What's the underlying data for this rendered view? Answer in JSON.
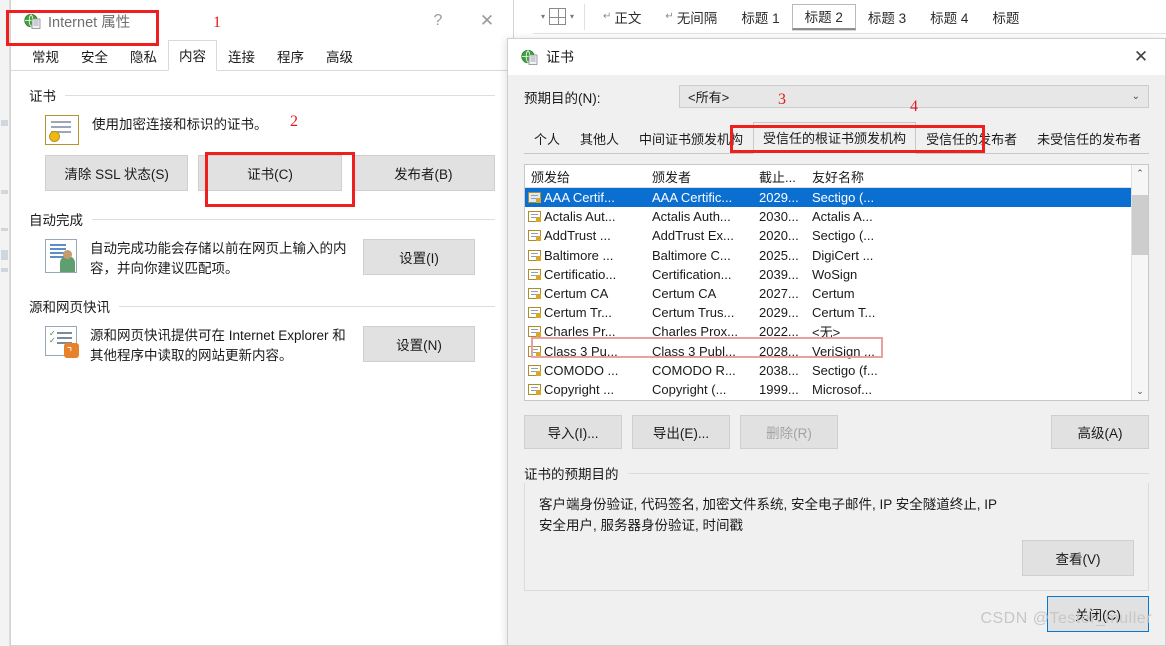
{
  "ribbon": {
    "table_button": "table-grid",
    "styles": [
      {
        "label": "正文",
        "pilcrow": "↵",
        "selected": false
      },
      {
        "label": "无间隔",
        "pilcrow": "↵",
        "selected": false
      },
      {
        "label": "标题 1",
        "pilcrow": "",
        "selected": false
      },
      {
        "label": "标题 2",
        "pilcrow": "",
        "selected": true
      },
      {
        "label": "标题 3",
        "pilcrow": "",
        "selected": false
      },
      {
        "label": "标题 4",
        "pilcrow": "",
        "selected": false
      },
      {
        "label": "标题",
        "pilcrow": "",
        "selected": false
      }
    ]
  },
  "internet_properties": {
    "title": "Internet 属性",
    "help_glyph": "?",
    "close_glyph": "✕",
    "tabs": [
      {
        "label": "常规",
        "active": false
      },
      {
        "label": "安全",
        "active": false
      },
      {
        "label": "隐私",
        "active": false
      },
      {
        "label": "内容",
        "active": true
      },
      {
        "label": "连接",
        "active": false
      },
      {
        "label": "程序",
        "active": false
      },
      {
        "label": "高级",
        "active": false
      }
    ],
    "certificates_group": {
      "title": "证书",
      "description": "使用加密连接和标识的证书。",
      "buttons": [
        {
          "label": "清除 SSL 状态(S)"
        },
        {
          "label": "证书(C)"
        },
        {
          "label": "发布者(B)"
        }
      ]
    },
    "autocomplete_group": {
      "title": "自动完成",
      "description": "自动完成功能会存储以前在网页上输入的内容，并向你建议匹配项。",
      "button": "设置(I)"
    },
    "feeds_group": {
      "title": "源和网页快讯",
      "description": "源和网页快讯提供可在 Internet Explorer 和其他程序中读取的网站更新内容。",
      "button": "设置(N)"
    }
  },
  "certificates_dialog": {
    "title": "证书",
    "close_glyph": "✕",
    "purpose": {
      "label": "预期目的(N):",
      "value": "<所有>",
      "caret": "⌄"
    },
    "tabs": [
      {
        "label": "个人",
        "active": false
      },
      {
        "label": "其他人",
        "active": false
      },
      {
        "label": "中间证书颁发机构",
        "active": false
      },
      {
        "label": "受信任的根证书颁发机构",
        "active": true
      },
      {
        "label": "受信任的发布者",
        "active": false
      },
      {
        "label": "未受信任的发布者",
        "active": false
      }
    ],
    "list": {
      "columns": [
        "颁发给",
        "颁发者",
        "截止...",
        "友好名称"
      ],
      "rows": [
        {
          "issued_to": "AAA Certif...",
          "issued_by": "AAA Certific...",
          "expires": "2029...",
          "friendly": "Sectigo (...",
          "selected": true,
          "highlight": false
        },
        {
          "issued_to": "Actalis Aut...",
          "issued_by": "Actalis Auth...",
          "expires": "2030...",
          "friendly": "Actalis A...",
          "selected": false,
          "highlight": false
        },
        {
          "issued_to": "AddTrust ...",
          "issued_by": "AddTrust Ex...",
          "expires": "2020...",
          "friendly": "Sectigo (...",
          "selected": false,
          "highlight": false
        },
        {
          "issued_to": "Baltimore ...",
          "issued_by": "Baltimore C...",
          "expires": "2025...",
          "friendly": "DigiCert ...",
          "selected": false,
          "highlight": false
        },
        {
          "issued_to": "Certificatio...",
          "issued_by": "Certification...",
          "expires": "2039...",
          "friendly": "WoSign",
          "selected": false,
          "highlight": false
        },
        {
          "issued_to": "Certum CA",
          "issued_by": "Certum CA",
          "expires": "2027...",
          "friendly": "Certum",
          "selected": false,
          "highlight": false
        },
        {
          "issued_to": "Certum Tr...",
          "issued_by": "Certum Trus...",
          "expires": "2029...",
          "friendly": "Certum T...",
          "selected": false,
          "highlight": false
        },
        {
          "issued_to": "Charles Pr...",
          "issued_by": "Charles Prox...",
          "expires": "2022...",
          "friendly": "<无>",
          "selected": false,
          "highlight": true
        },
        {
          "issued_to": "Class 3 Pu...",
          "issued_by": "Class 3 Publ...",
          "expires": "2028...",
          "friendly": "VeriSign ...",
          "selected": false,
          "highlight": false
        },
        {
          "issued_to": "COMODO ...",
          "issued_by": "COMODO R...",
          "expires": "2038...",
          "friendly": "Sectigo (f...",
          "selected": false,
          "highlight": false
        },
        {
          "issued_to": "Copyright ...",
          "issued_by": "Copyright (...",
          "expires": "1999...",
          "friendly": "Microsof...",
          "selected": false,
          "highlight": false
        }
      ],
      "scroll_up": "⌃",
      "scroll_down": "⌄"
    },
    "actions": {
      "import": "导入(I)...",
      "export": "导出(E)...",
      "remove": "删除(R)",
      "remove_disabled": true,
      "advanced": "高级(A)"
    },
    "purpose_group": {
      "title": "证书的预期目的",
      "text": "客户端身份验证, 代码签名, 加密文件系统, 安全电子邮件, IP 安全隧道终止, IP 安全用户, 服务器身份验证, 时间戳",
      "view_button": "查看(V)"
    },
    "close_button": "关闭(C)"
  },
  "annotations": [
    {
      "number": "1"
    },
    {
      "number": "2"
    },
    {
      "number": "3"
    },
    {
      "number": "4"
    }
  ],
  "watermark": "CSDN @Tester_muller",
  "colors": {
    "annotation_red": "#f01f1f",
    "selection_blue": "#0b6fd1",
    "accent_blue": "#0078d7"
  }
}
